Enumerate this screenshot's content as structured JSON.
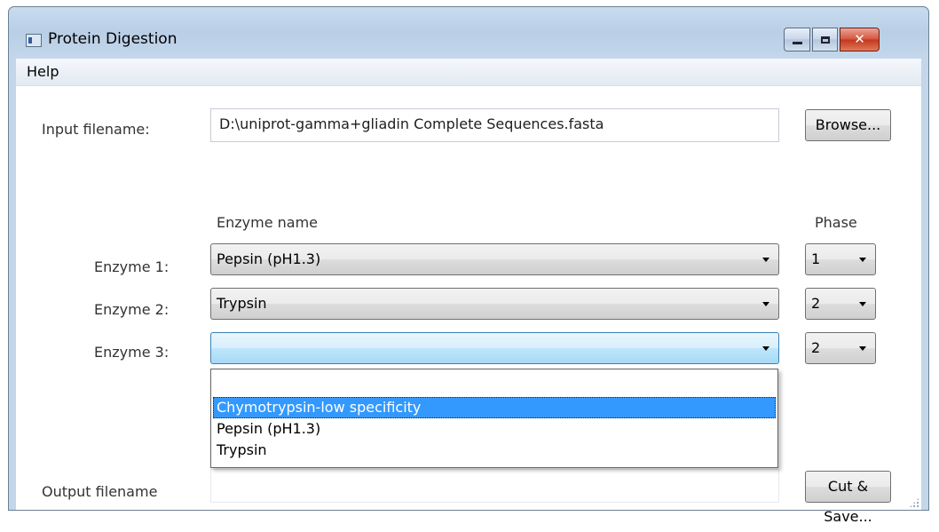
{
  "window": {
    "title": "Protein Digestion",
    "minimize_label": "",
    "close_symbol": "✕"
  },
  "menu": {
    "items": [
      {
        "label": "Help"
      }
    ]
  },
  "input": {
    "label": "Input filename:",
    "value": "D:\\uniprot-gamma+gliadin Complete Sequences.fasta",
    "browse_label": "Browse..."
  },
  "enzymes": {
    "name_header": "Enzyme name",
    "phase_header": "Phase",
    "rows": [
      {
        "label": "Enzyme 1:",
        "name": "Pepsin (pH1.3)",
        "phase": "1"
      },
      {
        "label": "Enzyme 2:",
        "name": "Trypsin",
        "phase": "2"
      },
      {
        "label": "Enzyme 3:",
        "name": "",
        "phase": "2"
      }
    ],
    "dropdown_options": [
      {
        "label": "",
        "selected": false
      },
      {
        "label": "Chymotrypsin-low specificity",
        "selected": true
      },
      {
        "label": "Pepsin (pH1.3)",
        "selected": false
      },
      {
        "label": "Trypsin",
        "selected": false
      }
    ]
  },
  "output": {
    "label": "Output filename",
    "value": "",
    "save_label": "Cut & Save..."
  },
  "colors": {
    "selection": "#3399ff",
    "active_combo": "#bde6fd",
    "close_button": "#c3361c"
  }
}
